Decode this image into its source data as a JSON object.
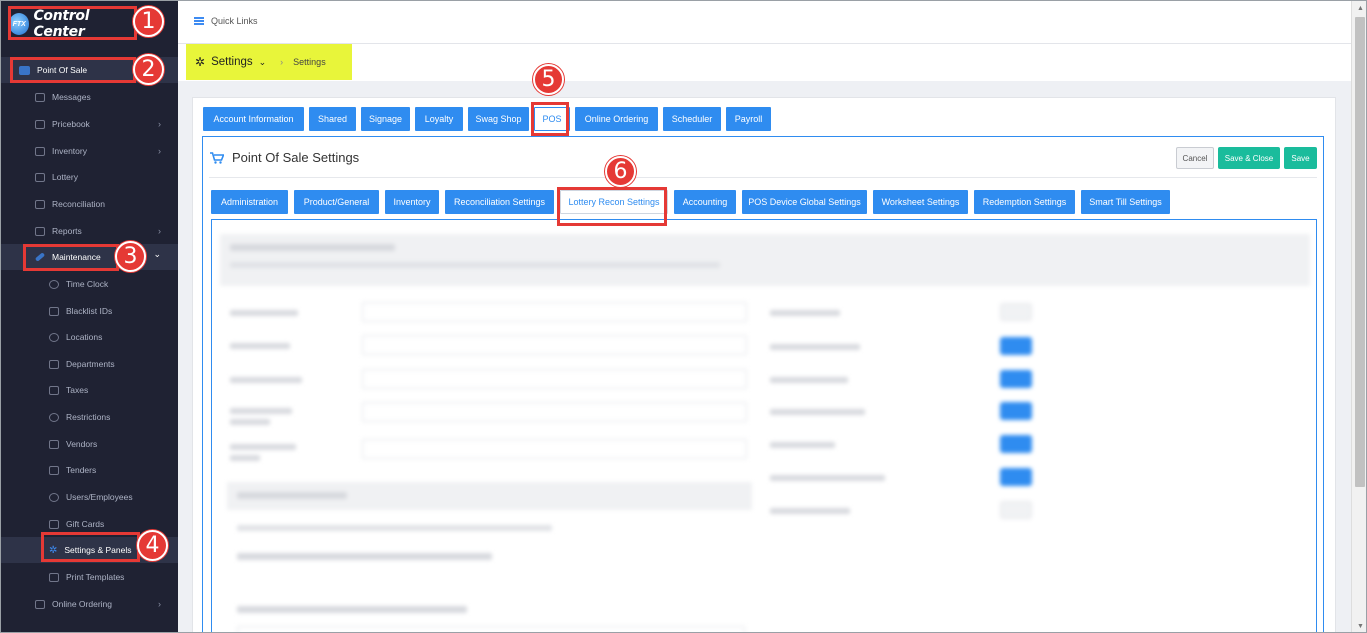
{
  "sidebar": {
    "logo_badge": "FTX",
    "logo_text": "Control Center",
    "items": [
      {
        "label": "Point Of Sale",
        "icon": "cart-icon"
      },
      {
        "label": "Messages",
        "icon": "message-icon"
      },
      {
        "label": "Pricebook",
        "icon": "pricebook-icon",
        "chevron": "›"
      },
      {
        "label": "Inventory",
        "icon": "inventory-icon",
        "chevron": "›"
      },
      {
        "label": "Lottery",
        "icon": "lottery-icon"
      },
      {
        "label": "Reconciliation",
        "icon": "reconciliation-icon"
      },
      {
        "label": "Reports",
        "icon": "reports-icon",
        "chevron": "›"
      },
      {
        "label": "Maintenance",
        "icon": "wrench-icon",
        "chevron": "⌄"
      }
    ],
    "maintenance_items": [
      {
        "label": "Time Clock",
        "icon": "clock-icon"
      },
      {
        "label": "Blacklist IDs",
        "icon": "id-card-icon"
      },
      {
        "label": "Locations",
        "icon": "location-pin-icon"
      },
      {
        "label": "Departments",
        "icon": "departments-icon"
      },
      {
        "label": "Taxes",
        "icon": "tax-icon"
      },
      {
        "label": "Restrictions",
        "icon": "restriction-icon"
      },
      {
        "label": "Vendors",
        "icon": "vendor-icon"
      },
      {
        "label": "Tenders",
        "icon": "tenders-icon"
      },
      {
        "label": "Users/Employees",
        "icon": "users-icon"
      },
      {
        "label": "Gift Cards",
        "icon": "gift-card-icon"
      },
      {
        "label": "Settings & Panels",
        "icon": "gear-icon"
      },
      {
        "label": "Print Templates",
        "icon": "printer-icon"
      }
    ],
    "online_ordering": {
      "label": "Online Ordering",
      "icon": "store-icon",
      "chevron": "›"
    }
  },
  "topbar": {
    "quick_links": "Quick Links"
  },
  "breadcrumb": {
    "title": "Settings",
    "dropdown": "⌄",
    "separator": "›",
    "current": "Settings"
  },
  "tabs": [
    "Account Information",
    "Shared",
    "Signage",
    "Loyalty",
    "Swag Shop",
    "POS",
    "Online Ordering",
    "Scheduler",
    "Payroll"
  ],
  "selected_tab": "POS",
  "pos_settings": {
    "title": "Point Of Sale Settings",
    "cancel": "Cancel",
    "save_close": "Save & Close",
    "save": "Save"
  },
  "subtabs": [
    "Administration",
    "Product/General",
    "Inventory",
    "Reconciliation Settings",
    "Lottery Recon Settings",
    "Accounting",
    "POS Device Global Settings",
    "Worksheet Settings",
    "Redemption Settings",
    "Smart Till Settings"
  ],
  "selected_subtab": "Lottery Recon Settings",
  "annotations": [
    "1",
    "2",
    "3",
    "4",
    "5",
    "6"
  ],
  "colors": {
    "sidebar_bg": "#1f2233",
    "accent_blue": "#2f8cf0",
    "green": "#1abc9c",
    "annotation_red": "#e53935",
    "breadcrumb_highlight": "#e8f53a"
  }
}
